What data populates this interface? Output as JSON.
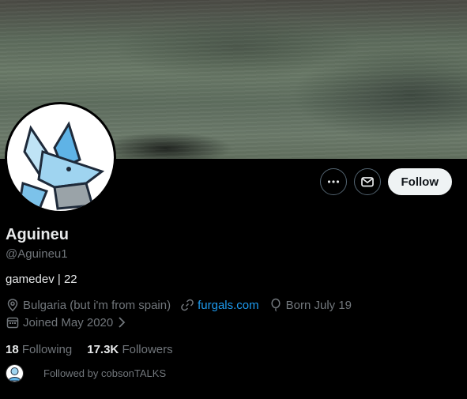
{
  "profile": {
    "display_name": "Aguineu",
    "handle": "@Aguineu1",
    "bio": "gamedev | 22"
  },
  "meta": {
    "location": "Bulgaria (but i'm from spain)",
    "website": "furgals.com",
    "birthday": "Born July 19",
    "joined": "Joined May 2020"
  },
  "stats": {
    "following_count": "18",
    "following_label": "Following",
    "followers_count": "17.3K",
    "followers_label": "Followers"
  },
  "followed_by": "Followed by cobsonTALKS",
  "actions": {
    "follow_label": "Follow"
  },
  "icons": [
    "more-icon",
    "mail-icon",
    "location-icon",
    "link-icon",
    "balloon-icon",
    "calendar-icon",
    "chevron-right-icon"
  ],
  "colors": {
    "accent": "#1d9bf0",
    "muted": "#71767b",
    "text": "#e7e9ea",
    "follow_bg": "#eff3f4"
  }
}
